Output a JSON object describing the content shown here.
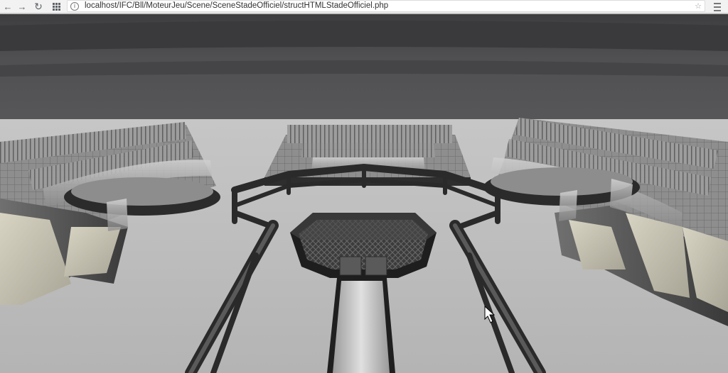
{
  "browser": {
    "url": "localhost/IFC/Bll/MoteurJeu/Scene/SceneStadeOfficiel/structHTMLStadeOfficiel.php",
    "back_icon": "back-arrow-icon",
    "forward_icon": "forward-arrow-icon",
    "reload_icon": "reload-icon",
    "apps_icon": "apps-grid-icon",
    "menu_icon": "hamburger-menu-icon"
  },
  "scene": {
    "sky_color": "#4d4d4f",
    "floor_color": "#bcbcbc"
  }
}
